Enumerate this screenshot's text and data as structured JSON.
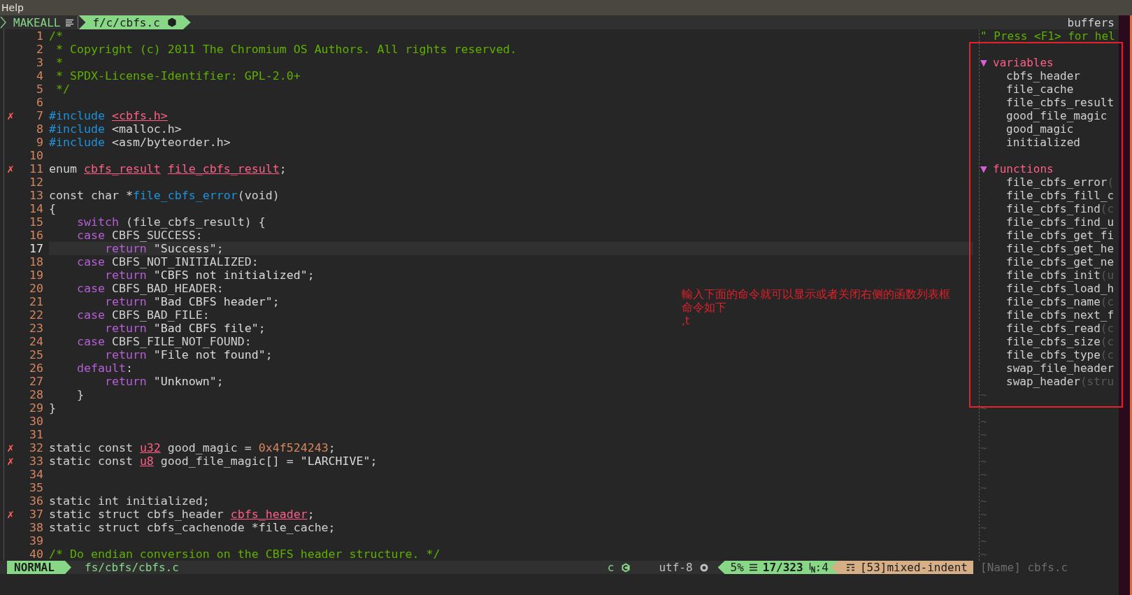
{
  "menu_bar": {
    "items": [
      "Help"
    ]
  },
  "tabline": {
    "buffer_label": "MAKEALL",
    "active_tab": {
      "label": "f/c/cbfs.c",
      "selected": true
    },
    "right_label": "buffers"
  },
  "editor": {
    "lines": [
      {
        "number": "1",
        "current": false,
        "tokens": [
          {
            "kind": "comment",
            "text": "/*"
          }
        ]
      },
      {
        "number": "2",
        "current": false,
        "tokens": [
          {
            "kind": "comment",
            "text": " * Copyright (c) 2011 The Chromium OS Authors. All rights reserved."
          }
        ]
      },
      {
        "number": "3",
        "current": false,
        "tokens": [
          {
            "kind": "comment",
            "text": " *"
          }
        ]
      },
      {
        "number": "4",
        "current": false,
        "tokens": [
          {
            "kind": "comment",
            "text": " * SPDX-License-Identifier: GPL-2.0+"
          }
        ]
      },
      {
        "number": "5",
        "current": false,
        "tokens": [
          {
            "kind": "comment",
            "text": " */"
          }
        ]
      },
      {
        "number": "6",
        "current": false
      },
      {
        "number": "7",
        "current": false,
        "sign": "✗",
        "tokens": [
          {
            "kind": "preproc",
            "text": "#include "
          },
          {
            "kind": "error",
            "text": "<cbfs.h>"
          }
        ]
      },
      {
        "number": "8",
        "current": false,
        "tokens": [
          {
            "kind": "preproc",
            "text": "#include"
          },
          {
            "kind": "plain",
            "text": " <malloc.h>"
          }
        ]
      },
      {
        "number": "9",
        "current": false,
        "tokens": [
          {
            "kind": "preproc",
            "text": "#include"
          },
          {
            "kind": "plain",
            "text": " <asm/byteorder.h>"
          }
        ]
      },
      {
        "number": "10",
        "current": false
      },
      {
        "number": "11",
        "current": false,
        "sign": "✗",
        "tokens": [
          {
            "kind": "plain",
            "text": "enum "
          },
          {
            "kind": "error",
            "text": "cbfs_result"
          },
          {
            "kind": "error",
            "text": "file_cbfs_result"
          },
          {
            "kind": "plain",
            "text": ";"
          }
        ]
      },
      {
        "number": "12",
        "current": false
      },
      {
        "number": "13",
        "current": false,
        "tokens": [
          {
            "kind": "plain",
            "text": "const char *"
          },
          {
            "kind": "func",
            "text": "file_cbfs_error"
          },
          {
            "kind": "plain",
            "text": "(void)"
          }
        ]
      },
      {
        "number": "14",
        "current": false,
        "tokens": [
          {
            "kind": "plain",
            "text": "{"
          }
        ]
      },
      {
        "number": "15",
        "current": false,
        "tokens": [
          {
            "kind": "keyword",
            "text": "    switch"
          },
          {
            "kind": "plain",
            "text": " (file_cbfs_result) {"
          }
        ]
      },
      {
        "number": "16",
        "current": false,
        "tokens": [
          {
            "kind": "keyword",
            "text": "    case"
          },
          {
            "kind": "plain",
            "text": " CBFS_SUCCESS:"
          }
        ]
      },
      {
        "number": "17",
        "current": true,
        "tokens": [
          {
            "kind": "keyword",
            "text": "        return "
          },
          {
            "kind": "string",
            "text": "\"Success\""
          },
          {
            "kind": "plain",
            "text": ";"
          }
        ]
      },
      {
        "number": "18",
        "current": false,
        "tokens": [
          {
            "kind": "keyword",
            "text": "    case"
          },
          {
            "kind": "plain",
            "text": " CBFS_NOT_INITIALIZED:"
          }
        ]
      },
      {
        "number": "19",
        "current": false,
        "tokens": [
          {
            "kind": "keyword",
            "text": "        return "
          },
          {
            "kind": "string",
            "text": "\"CBFS not initialized\""
          },
          {
            "kind": "plain",
            "text": ";"
          }
        ]
      },
      {
        "number": "20",
        "current": false,
        "tokens": [
          {
            "kind": "keyword",
            "text": "    case"
          },
          {
            "kind": "plain",
            "text": " CBFS_BAD_HEADER:"
          }
        ]
      },
      {
        "number": "21",
        "current": false,
        "tokens": [
          {
            "kind": "keyword",
            "text": "        return "
          },
          {
            "kind": "string",
            "text": "\"Bad CBFS header\""
          },
          {
            "kind": "plain",
            "text": ";"
          }
        ]
      },
      {
        "number": "22",
        "current": false,
        "tokens": [
          {
            "kind": "keyword",
            "text": "    case"
          },
          {
            "kind": "plain",
            "text": " CBFS_BAD_FILE:"
          }
        ]
      },
      {
        "number": "23",
        "current": false,
        "tokens": [
          {
            "kind": "keyword",
            "text": "        return "
          },
          {
            "kind": "string",
            "text": "\"Bad CBFS file\""
          },
          {
            "kind": "plain",
            "text": ";"
          }
        ]
      },
      {
        "number": "24",
        "current": false,
        "tokens": [
          {
            "kind": "keyword",
            "text": "    case"
          },
          {
            "kind": "plain",
            "text": " CBFS_FILE_NOT_FOUND:"
          }
        ]
      },
      {
        "number": "25",
        "current": false,
        "tokens": [
          {
            "kind": "keyword",
            "text": "        return "
          },
          {
            "kind": "string",
            "text": "\"File not found\""
          },
          {
            "kind": "plain",
            "text": ";"
          }
        ]
      },
      {
        "number": "26",
        "current": false,
        "tokens": [
          {
            "kind": "keyword",
            "text": "    default"
          },
          {
            "kind": "plain",
            "text": ":"
          }
        ]
      },
      {
        "number": "27",
        "current": false,
        "tokens": [
          {
            "kind": "keyword",
            "text": "        return "
          },
          {
            "kind": "string",
            "text": "\"Unknown\""
          },
          {
            "kind": "plain",
            "text": ";"
          }
        ]
      },
      {
        "number": "28",
        "current": false,
        "tokens": [
          {
            "kind": "plain",
            "text": "    }"
          }
        ]
      },
      {
        "number": "29",
        "current": false,
        "tokens": [
          {
            "kind": "plain",
            "text": "}"
          }
        ]
      },
      {
        "number": "30",
        "current": false
      },
      {
        "number": "31",
        "current": false
      },
      {
        "number": "32",
        "current": false,
        "sign": "✗",
        "tokens": [
          {
            "kind": "plain",
            "text": "static const "
          },
          {
            "kind": "error",
            "text": "u32"
          },
          {
            "kind": "plain",
            "text": " good_magic = "
          },
          {
            "kind": "number",
            "text": "0x4f524243"
          },
          {
            "kind": "plain",
            "text": ";"
          }
        ]
      },
      {
        "number": "33",
        "current": false,
        "sign": "✗",
        "tokens": [
          {
            "kind": "plain",
            "text": "static const "
          },
          {
            "kind": "error",
            "text": "u8"
          },
          {
            "kind": "plain",
            "text": " good_file_magic[] = "
          },
          {
            "kind": "string",
            "text": "\"LARCHIVE\""
          },
          {
            "kind": "plain",
            "text": ";"
          }
        ]
      },
      {
        "number": "34",
        "current": false
      },
      {
        "number": "35",
        "current": false
      },
      {
        "number": "36",
        "current": false,
        "tokens": [
          {
            "kind": "plain",
            "text": "static int initialized;"
          }
        ]
      },
      {
        "number": "37",
        "current": false,
        "sign": "✗",
        "tokens": [
          {
            "kind": "plain",
            "text": "static struct cbfs_header "
          },
          {
            "kind": "error",
            "text": "cbfs_header"
          },
          {
            "kind": "plain",
            "text": ";"
          }
        ]
      },
      {
        "number": "38",
        "current": false,
        "tokens": [
          {
            "kind": "plain",
            "text": "static struct cbfs_cachenode *file_cache;"
          }
        ]
      },
      {
        "number": "39",
        "current": false
      },
      {
        "number": "40",
        "current": false,
        "tokens": [
          {
            "kind": "comment",
            "text": "/* Do endian conversion on the CBFS header structure. */"
          }
        ]
      }
    ]
  },
  "tagbar": {
    "help": "\" Press <F1> for hel",
    "groups": [
      {
        "marker": "▼",
        "title": "variables",
        "items": [
          {
            "name": "cbfs_header"
          },
          {
            "name": "file_cache"
          },
          {
            "name": "file_cbfs_result"
          },
          {
            "name": "good_file_magic"
          },
          {
            "name": "good_magic"
          },
          {
            "name": "initialized"
          }
        ]
      },
      {
        "marker": "▼",
        "title": "functions",
        "items": [
          {
            "name": "file_cbfs_error",
            "signature": "("
          },
          {
            "name": "file_cbfs_fill_c"
          },
          {
            "name": "file_cbfs_find",
            "signature": "(c"
          },
          {
            "name": "file_cbfs_find_u"
          },
          {
            "name": "file_cbfs_get_fi"
          },
          {
            "name": "file_cbfs_get_he"
          },
          {
            "name": "file_cbfs_get_ne"
          },
          {
            "name": "file_cbfs_init",
            "signature": "(u"
          },
          {
            "name": "file_cbfs_load_h"
          },
          {
            "name": "file_cbfs_name",
            "signature": "(c"
          },
          {
            "name": "file_cbfs_next_f"
          },
          {
            "name": "file_cbfs_read",
            "signature": "(c"
          },
          {
            "name": "file_cbfs_size",
            "signature": "(c"
          },
          {
            "name": "file_cbfs_type",
            "signature": "(c"
          },
          {
            "name": "swap_file_header"
          },
          {
            "name": "swap_header",
            "signature": "(stru"
          }
        ]
      }
    ],
    "filler": [
      "~",
      "~",
      "~",
      "~",
      "~",
      "~",
      "~",
      "~",
      "~",
      "~",
      "~",
      "~",
      "~"
    ]
  },
  "annotation": {
    "lines": [
      "輸入下面的命令就可以显示或者关闭右侧的函数列表框",
      "命令如下",
      ",t"
    ]
  },
  "status_bar": {
    "mode": "NORMAL",
    "file": "fs/cbfs/cbfs.c",
    "filetype": "c",
    "encoding": "utf-8",
    "percent": "5%",
    "position": "17/323",
    "column": ":4",
    "warning": "[53]mixed-indent",
    "tagbar_status": "[Name] cbfs.c"
  }
}
